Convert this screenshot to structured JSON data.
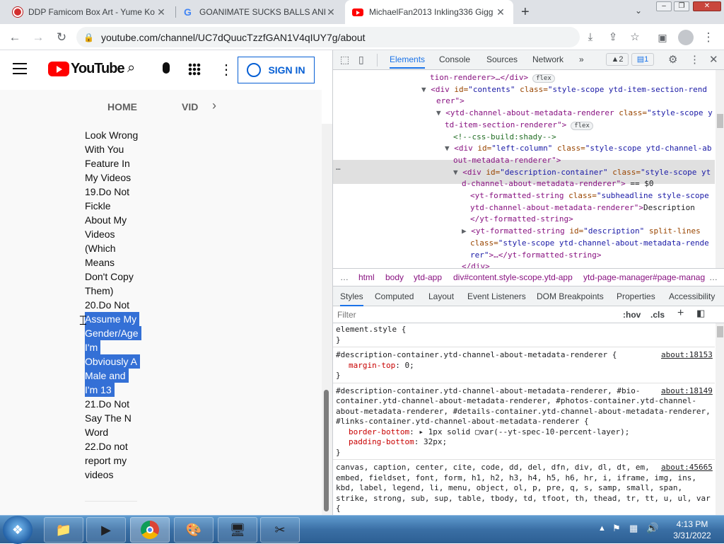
{
  "browser": {
    "tabs": [
      {
        "title": "DDP Famicom Box Art - Yume Ko",
        "icon": "mario-favicon-icon"
      },
      {
        "title": "GOANIMATE SUCKS BALLS AND",
        "icon": "google-favicon-icon"
      },
      {
        "title": "MichaelFan2013 Inkling336 Gigg",
        "icon": "youtube-favicon-icon"
      }
    ],
    "url": "youtube.com/channel/UC7dQuucTzzfGAN1V4qIUY7g/about"
  },
  "youtube": {
    "logo": "YouTube",
    "sign_in": "SIGN IN",
    "tabs": [
      "HOME",
      "VID"
    ],
    "description_lines": [
      "Look Wrong",
      "With You",
      "Feature In",
      "My Videos",
      "19.Do Not",
      "Fickle",
      "About My",
      "Videos",
      "(Which",
      "Means",
      "Don't Copy",
      "Them)",
      "20.Do Not"
    ],
    "selected_lines": [
      "Assume My",
      "Gender/Age",
      "I'm",
      "Obviously A",
      "Male and",
      "I'm 13"
    ],
    "after_lines": [
      "21.Do Not",
      "Say The N",
      "Word",
      "22.Do not",
      "report my",
      "videos"
    ]
  },
  "devtools": {
    "tabs": [
      "Elements",
      "Console",
      "Sources",
      "Network",
      "»"
    ],
    "warnings": "2",
    "messages": "1",
    "dom": [
      {
        "indent": 0,
        "tag": "tion-renderer",
        "extra": ">…</div>",
        "badge": "flex"
      },
      {
        "indent": 1,
        "open": "<div ",
        "attr": "id=",
        "val": "\"contents\"",
        "attr2": " class=",
        "val2": "\"style-scope ytd-item-section-rend"
      },
      {
        "indent": 1,
        "cont": "erer\">"
      },
      {
        "indent": 2,
        "open": "<ytd-channel-about-metadata-renderer ",
        "attr": "class=",
        "val": "\"style-scope y"
      },
      {
        "indent": 2,
        "cont": "td-item-section-renderer\">",
        "badge": "flex"
      },
      {
        "indent": 3,
        "comment": "<!--css-build:shady-->"
      },
      {
        "indent": 3,
        "open": "<div ",
        "attr": "id=",
        "val": "\"left-column\"",
        "attr2": " class=",
        "val2": "\"style-scope ytd-channel-ab"
      },
      {
        "indent": 3,
        "cont": "out-metadata-renderer\">"
      },
      {
        "indent": 4,
        "open": "<div ",
        "attr": "id=",
        "val": "\"description-container\"",
        "attr2": " class=",
        "val2": "\"style-scope yt"
      },
      {
        "indent": 4,
        "cont": "d-channel-about-metadata-renderer\">",
        "eq": " == $0"
      },
      {
        "indent": 5,
        "open": "<yt-formatted-string ",
        "attr": "class=",
        "val": "\"subheadline style-scope"
      },
      {
        "indent": 5,
        "cont": "ytd-channel-about-metadata-renderer\">",
        "text": "Description"
      },
      {
        "indent": 5,
        "cont": "</yt-formatted-string>"
      },
      {
        "indent": 5,
        "open": "<yt-formatted-string ",
        "attr": "id=",
        "val": "\"description\"",
        "attr2": " split-lines",
        "val2": ""
      },
      {
        "indent": 5,
        "attr": "class=",
        "val": "\"style-scope ytd-channel-about-metadata-rende"
      },
      {
        "indent": 5,
        "val": "rer\"",
        "cont": ">…</yt-formatted-string>"
      },
      {
        "indent": 4,
        "cont": "</div>"
      }
    ],
    "breadcrumbs": [
      "…",
      "html",
      "body",
      "ytd-app",
      "div#content.style-scope.ytd-app",
      "ytd-page-manager#page-manag",
      "…"
    ],
    "subtabs": [
      "Styles",
      "Computed",
      "Layout",
      "Event Listeners",
      "DOM Breakpoints",
      "Properties",
      "Accessibility"
    ],
    "filter_placeholder": "Filter",
    "hov": ":hov",
    "cls": ".cls",
    "styles": [
      {
        "selector": "element.style {",
        "props": [],
        "close": "}"
      },
      {
        "selector": "#description-container.ytd-channel-about-metadata-renderer {",
        "link": "about:18153",
        "props": [
          {
            "name": "margin-top",
            "value": "0;"
          }
        ],
        "close": "}"
      },
      {
        "selector_lines": [
          "#description-container.ytd-channel-about-metadata-renderer, #bio-",
          "container.ytd-channel-about-metadata-renderer, #photos-container.ytd-channel-",
          "about-metadata-renderer, #details-container.ytd-channel-about-metadata-renderer,",
          "#links-container.ytd-channel-about-metadata-renderer {"
        ],
        "link": "about:18149",
        "props": [
          {
            "name": "border-bottom",
            "value": "▸ 1px solid ▢var(--yt-spec-10-percent-layer);"
          },
          {
            "name": "padding-bottom",
            "value": "32px;"
          }
        ],
        "close": "}"
      },
      {
        "selector_lines": [
          "canvas, caption, center, cite, code, dd, del, dfn, div, dl, dt, em,",
          "embed, fieldset, font, form, h1, h2, h3, h4, h5, h6, hr, i, iframe, img, ins,",
          "kbd, label, legend, li, menu, object, ol, p, pre, q, s, samp, small, span,",
          "strike, strong, sub, sup, table, tbody, td, tfoot, th, thead, tr, tt, u, ul, var",
          "{"
        ],
        "link": "about:45665",
        "props": [],
        "close": ""
      }
    ]
  },
  "taskbar": {
    "time": "4:13 PM",
    "date": "3/31/2022"
  }
}
